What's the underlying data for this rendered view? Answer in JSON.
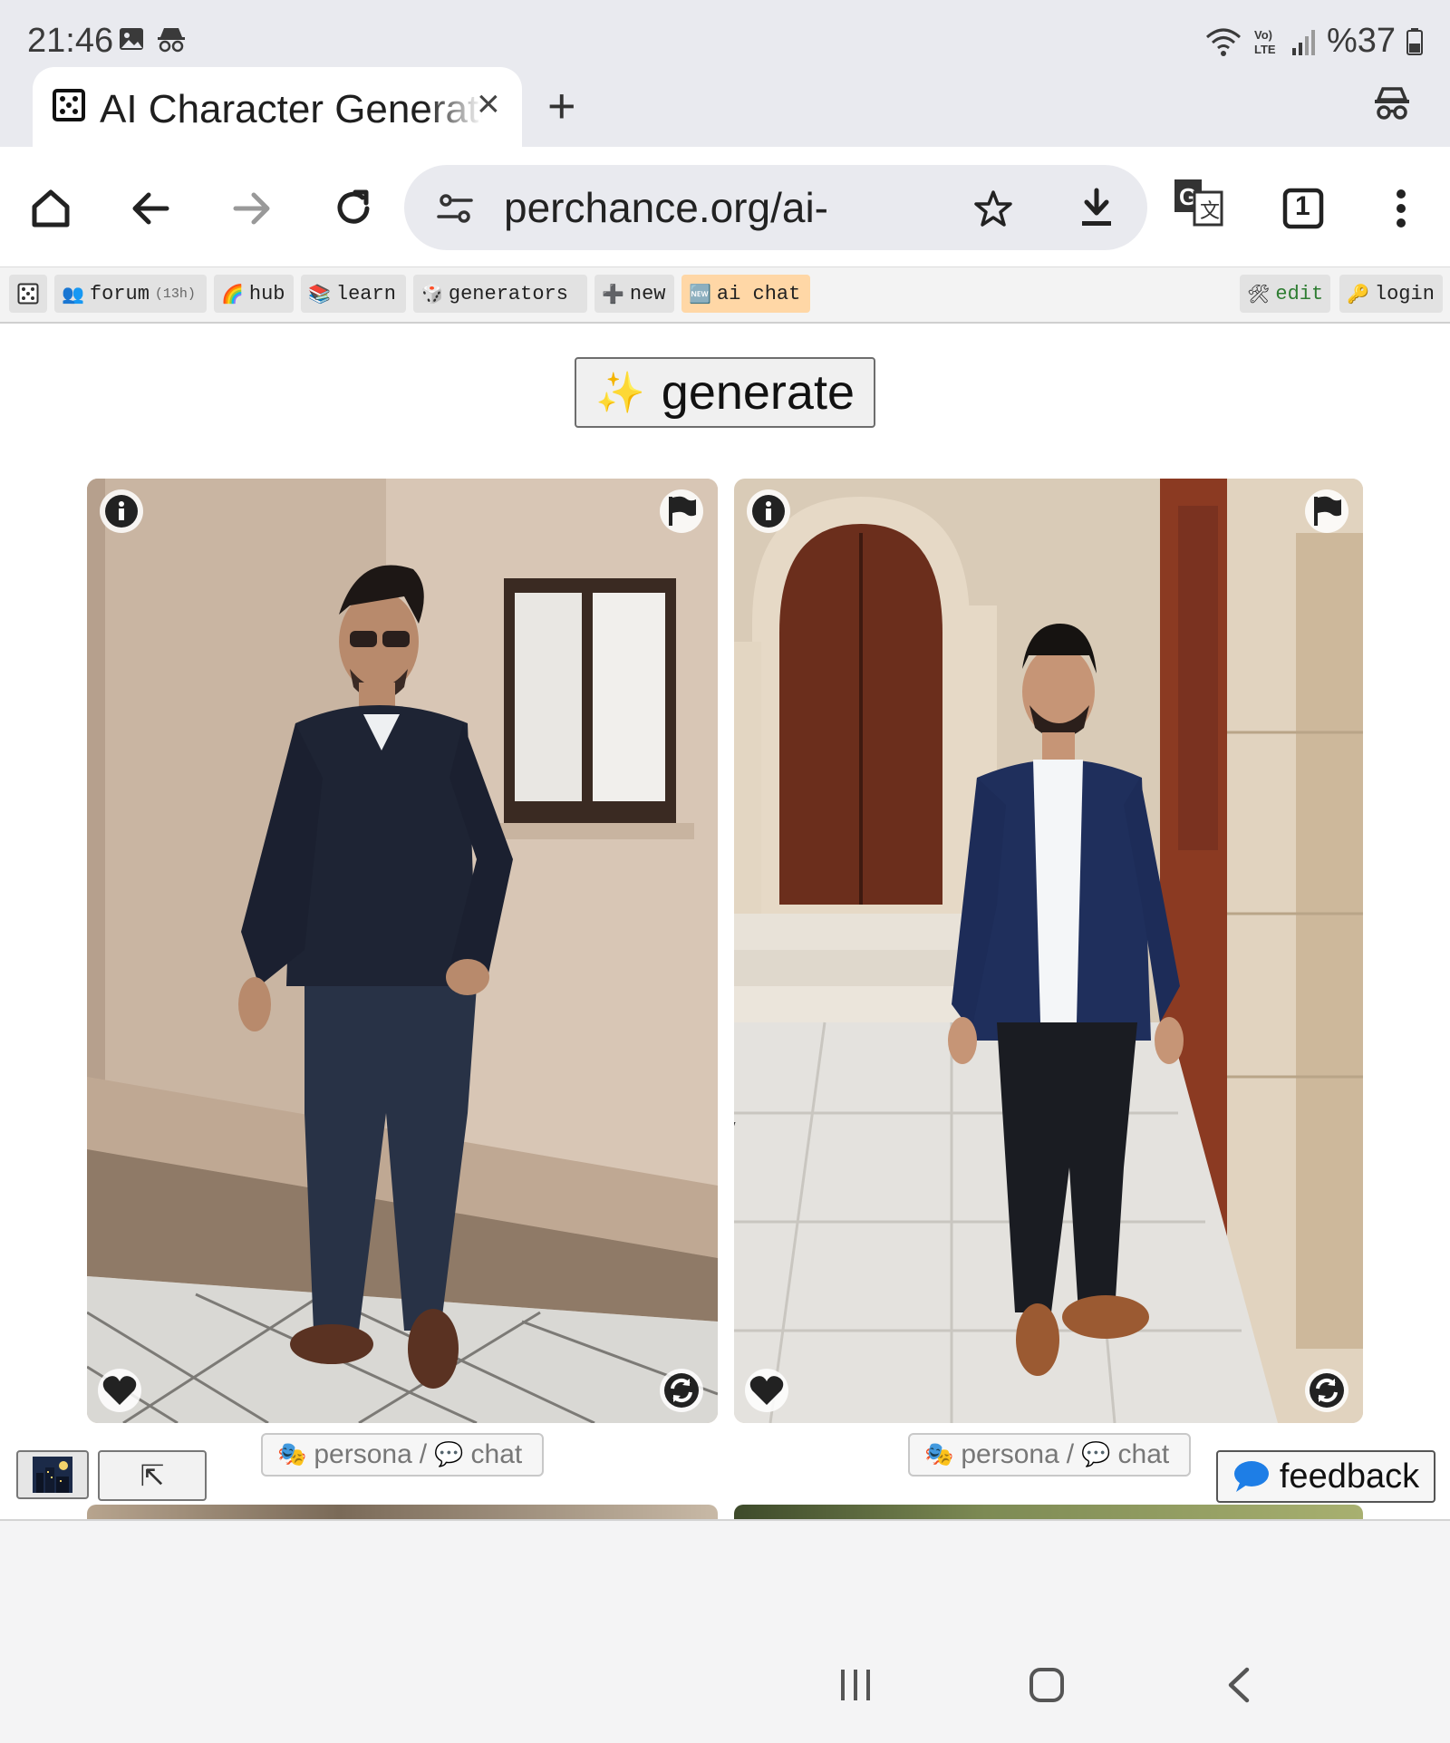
{
  "status_bar": {
    "time": "21:46",
    "battery": "%37"
  },
  "tab": {
    "title": "AI Character Generator",
    "close_glyph": "×",
    "new_tab_glyph": "+"
  },
  "toolbar": {
    "url": "perchance.org/ai-character-generator",
    "tab_count": "1"
  },
  "perchance_bar": {
    "items": [
      {
        "label": "forum",
        "meta": "(13h)",
        "emoji": "👥"
      },
      {
        "label": "hub",
        "emoji": "🌈"
      },
      {
        "label": "learn",
        "emoji": "📚"
      },
      {
        "label": "generators",
        "emoji": "🎲"
      },
      {
        "label": "new",
        "emoji": "➕"
      },
      {
        "label": "ai chat",
        "emoji": "🆕"
      }
    ],
    "edit": {
      "label": "edit",
      "emoji": "🛠"
    },
    "login": {
      "label": "login",
      "emoji": "🔑"
    }
  },
  "generate": {
    "label": "generate",
    "emoji": "✨"
  },
  "cards": [
    {
      "persona_label": "persona",
      "chat_label": "chat",
      "separator": "/"
    },
    {
      "persona_label": "persona",
      "chat_label": "chat",
      "separator": "/"
    }
  ],
  "feedback": {
    "label": "feedback"
  },
  "mini_buttons": {
    "collapse_glyph": "⇱"
  },
  "colors": {
    "tab_bg": "#e9eaef",
    "ai_chat_highlight": "#ffd7a6",
    "edit_green": "#2e7d32"
  }
}
